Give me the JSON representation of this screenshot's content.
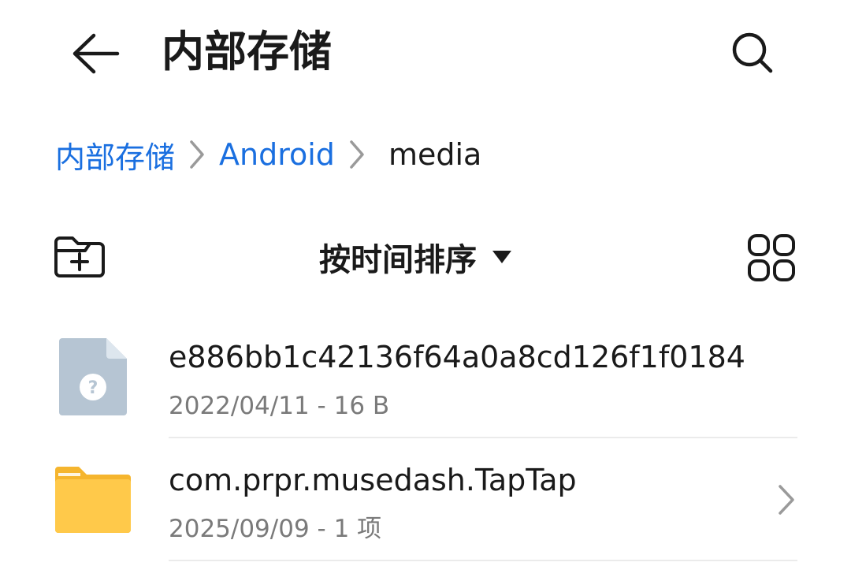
{
  "header": {
    "title": "内部存储",
    "back_icon": "back-arrow-icon",
    "search_icon": "search-icon"
  },
  "breadcrumb": {
    "items": [
      {
        "label": "内部存储",
        "is_link": true
      },
      {
        "label": "Android",
        "is_link": true
      },
      {
        "label": "media",
        "is_link": false
      }
    ],
    "separator_icon": "chevron-right-icon",
    "link_color": "#1a6fe0"
  },
  "toolbar": {
    "new_folder_icon": "new-folder-icon",
    "sort_label": "按时间排序",
    "sort_caret_icon": "caret-down-icon",
    "view_toggle_icon": "grid-view-icon"
  },
  "files": [
    {
      "name": "e886bb1c42136f64a0a8cd126f1f0184",
      "date": "2022/04/11",
      "size": "16 B",
      "type": "unknown-file",
      "icon": "unknown-file-icon",
      "icon_color": "#b6c5d3"
    },
    {
      "name": "com.prpr.musedash.TapTap",
      "date": "2025/09/09",
      "size": "1 项",
      "type": "folder",
      "icon": "folder-icon",
      "icon_color": "#ffc94a"
    }
  ]
}
